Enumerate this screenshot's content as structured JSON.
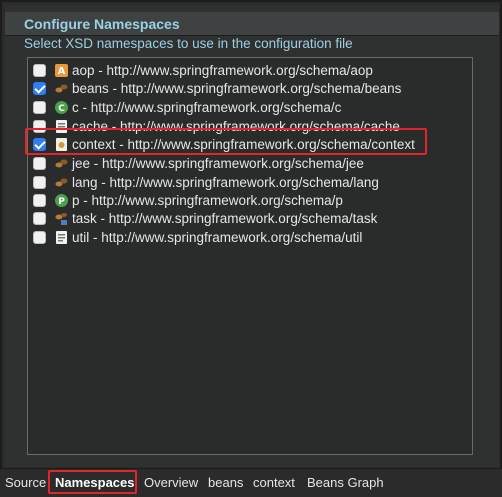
{
  "section": {
    "title": "Configure Namespaces",
    "description": "Select XSD namespaces to use in the configuration file"
  },
  "namespaces": [
    {
      "label": "aop - http://www.springframework.org/schema/aop",
      "checked": false,
      "icon": "aop-icon"
    },
    {
      "label": "beans - http://www.springframework.org/schema/beans",
      "checked": true,
      "icon": "beans-icon"
    },
    {
      "label": "c - http://www.springframework.org/schema/c",
      "checked": false,
      "icon": "c-icon"
    },
    {
      "label": "cache - http://www.springframework.org/schema/cache",
      "checked": false,
      "icon": "cache-icon"
    },
    {
      "label": "context - http://www.springframework.org/schema/context",
      "checked": true,
      "icon": "context-icon"
    },
    {
      "label": "jee - http://www.springframework.org/schema/jee",
      "checked": false,
      "icon": "jee-icon"
    },
    {
      "label": "lang - http://www.springframework.org/schema/lang",
      "checked": false,
      "icon": "lang-icon"
    },
    {
      "label": "p - http://www.springframework.org/schema/p",
      "checked": false,
      "icon": "p-icon"
    },
    {
      "label": "task - http://www.springframework.org/schema/task",
      "checked": false,
      "icon": "task-icon"
    },
    {
      "label": "util - http://www.springframework.org/schema/util",
      "checked": false,
      "icon": "util-icon"
    }
  ],
  "tabs": {
    "source": "Source",
    "namespaces": "Namespaces",
    "overview": "Overview",
    "beans": "beans",
    "context": "context",
    "beans_graph": "Beans Graph"
  },
  "colors": {
    "accent_text": "#9bd1e4",
    "highlight": "#e0262a",
    "checkbox_checked": "#2f7ff2"
  }
}
